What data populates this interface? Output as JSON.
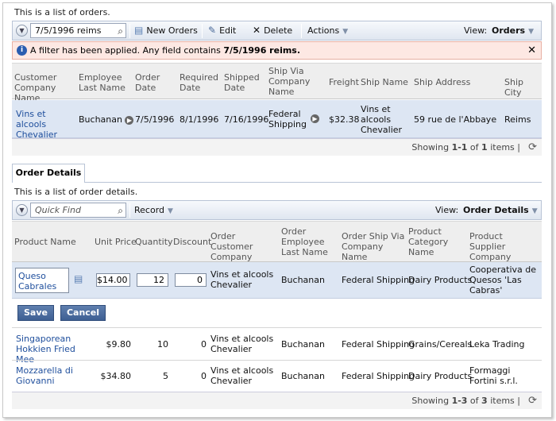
{
  "orders": {
    "description": "This is a list of orders.",
    "toolbar": {
      "quick_find_value": "7/5/1996 reims",
      "new_label": "New Orders",
      "edit_label": "Edit",
      "delete_label": "Delete",
      "actions_label": "Actions",
      "view_label": "View:",
      "view_value": "Orders"
    },
    "alert": {
      "prefix": "A filter has been applied. Any field contains ",
      "value": "7/5/1996 reims."
    },
    "columns": [
      "Customer Company Name",
      "Employee Last Name",
      "Order Date",
      "Required Date",
      "Shipped Date",
      "Ship Via Company Name",
      "Freight",
      "Ship Name",
      "Ship Address",
      "Ship City"
    ],
    "row": {
      "customer": "Vins et alcools Chevalier",
      "employee": "Buchanan",
      "order_date": "7/5/1996",
      "required_date": "8/1/1996",
      "shipped_date": "7/16/1996",
      "ship_via": "Federal Shipping",
      "freight": "$32.38",
      "ship_name": "Vins et alcools Chevalier",
      "ship_address": "59 rue de l'Abbaye",
      "ship_city": "Reims"
    },
    "footer": {
      "showing": "Showing ",
      "range": "1-1",
      "of": " of ",
      "total": "1",
      "items": " items |"
    }
  },
  "details": {
    "tab_label": "Order Details",
    "description": "This is a list of order details.",
    "toolbar": {
      "quick_find_placeholder": "Quick Find",
      "record_label": "Record",
      "view_label": "View:",
      "view_value": "Order Details"
    },
    "columns": [
      "Product Name",
      "Unit Price",
      "Quantity",
      "Discount",
      "Order Customer Company Name",
      "Order Employee Last Name",
      "Order Ship Via Company Name",
      "Product Category Name",
      "Product Supplier Company Name"
    ],
    "edit_row": {
      "product": "Queso Cabrales",
      "unit_price": "$14.00",
      "quantity": "12",
      "discount": "0",
      "customer": "Vins et alcools Chevalier",
      "employee": "Buchanan",
      "ship_via": "Federal Shipping",
      "category": "Dairy Products",
      "supplier": "Cooperativa de Quesos 'Las Cabras'"
    },
    "save_label": "Save",
    "cancel_label": "Cancel",
    "rows": [
      {
        "product": "Singaporean Hokkien Fried Mee",
        "unit_price": "$9.80",
        "quantity": "10",
        "discount": "0",
        "customer": "Vins et alcools Chevalier",
        "employee": "Buchanan",
        "ship_via": "Federal Shipping",
        "category": "Grains/Cereals",
        "supplier": "Leka Trading"
      },
      {
        "product": "Mozzarella di Giovanni",
        "unit_price": "$34.80",
        "quantity": "5",
        "discount": "0",
        "customer": "Vins et alcools Chevalier",
        "employee": "Buchanan",
        "ship_via": "Federal Shipping",
        "category": "Dairy Products",
        "supplier": "Formaggi Fortini s.r.l."
      }
    ],
    "footer": {
      "showing": "Showing ",
      "range": "1-3",
      "of": " of ",
      "total": "3",
      "items": " items |"
    }
  },
  "colors": {
    "accent": "#1e4e9c",
    "alert_bg": "#fde8e3",
    "selected_row": "#dde6f3",
    "button": "#4a6aa0"
  }
}
